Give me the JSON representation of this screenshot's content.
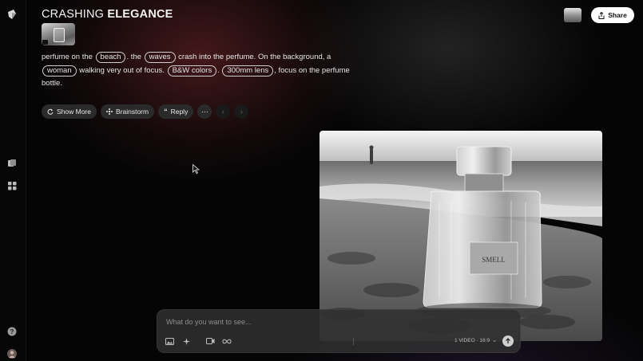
{
  "header": {
    "title_light": "CRASHING",
    "title_bold": "ELEGANCE",
    "share_label": "Share"
  },
  "prompt": {
    "seg_1": "perfume on the",
    "chip_beach": "beach",
    "seg_2": ". the",
    "chip_waves": "waves",
    "seg_3": "crash into the perfume. On the background, a",
    "chip_woman": "woman",
    "seg_4": "walking very out of focus.",
    "chip_bw": "B&W colors",
    "seg_5": ".",
    "chip_lens": "300mm lens",
    "seg_6": ", focus on the perfume bottle."
  },
  "actions": {
    "show_more": "Show More",
    "brainstorm": "Brainstorm",
    "reply": "Reply"
  },
  "image": {
    "bottle_label": "SMELL"
  },
  "composer": {
    "placeholder": "What do you want to see...",
    "settings_label": "1 VIDEO · 16:9"
  },
  "colors": {
    "background": "#050505",
    "chip_border": "#cfcfcf",
    "button_bg": "#2a2a2a",
    "share_bg": "#ffffff",
    "glow": "#78282d"
  },
  "icons": {
    "logo": "app-logo-icon",
    "sidebar_1": "boards-icon",
    "sidebar_2": "grid-icon",
    "help": "help-icon",
    "avatar": "avatar"
  }
}
